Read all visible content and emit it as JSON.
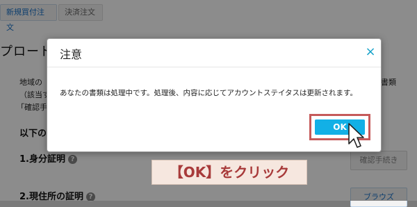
{
  "background_page": {
    "top_buttons": {
      "primary_label": "新規買付注文",
      "secondary_label": "決済注文"
    },
    "heading": "プロード",
    "description": {
      "line1": "地域の",
      "line2": "（該当す",
      "line3": "「確認手",
      "line1_right": "書類"
    },
    "subheading": "以下の",
    "rows": [
      {
        "label": "1.身分証明",
        "help": "?",
        "button": "確認手続き"
      },
      {
        "label": "2.現住所の証明",
        "help": "?",
        "button": "ブラウズ"
      }
    ]
  },
  "modal": {
    "title": "注意",
    "close_symbol": "×",
    "message": "あなたの書類は処理中です。処理後、内容に応じてアカウントステイタスは更新されます。",
    "ok_label": "OK"
  },
  "annotation": {
    "text": "【OK】をクリック"
  },
  "colors": {
    "accent": "#12b0e6",
    "highlight_frame": "#c55a5a",
    "annotation_bg": "#f6e7df",
    "annotation_text": "#a83a3a"
  }
}
